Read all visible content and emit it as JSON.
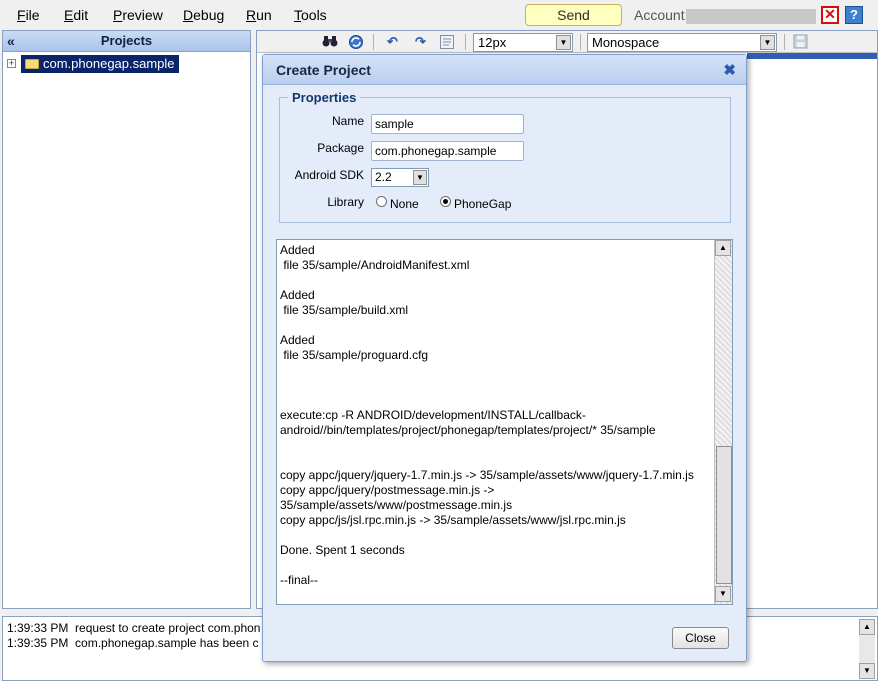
{
  "menu": {
    "items": [
      "File",
      "Edit",
      "Preview",
      "Debug",
      "Run",
      "Tools"
    ],
    "feedback_label": "Send Feedback",
    "account_label": "Account:"
  },
  "projects": {
    "title": "Projects",
    "collapse_glyph": "«",
    "items": [
      {
        "label": "com.phonegap.sample",
        "expander": "+"
      }
    ]
  },
  "toolbar": {
    "font_size": "12px",
    "font_family": "Monospace",
    "icons": [
      "binoculars-icon",
      "globe-refresh-icon",
      "undo-icon",
      "redo-icon",
      "format-icon",
      "save-icon"
    ]
  },
  "dialog": {
    "title": "Create Project",
    "close_glyph": "✖",
    "properties_legend": "Properties",
    "name_label": "Name",
    "name_value": "sample",
    "package_label": "Package",
    "package_value": "com.phonegap.sample",
    "sdk_label": "Android SDK",
    "sdk_value": "2.2",
    "library_label": "Library",
    "library_options": [
      {
        "label": "None",
        "checked": false
      },
      {
        "label": "PhoneGap",
        "checked": true
      }
    ],
    "output": "Added\n file 35/sample/AndroidManifest.xml\n\nAdded\n file 35/sample/build.xml\n\nAdded\n file 35/sample/proguard.cfg\n\n\n\nexecute:cp -R ANDROID/development/INSTALL/callback-android//bin/templates/project/phonegap/templates/project/* 35/sample\n\n\ncopy appc/jquery/jquery-1.7.min.js -> 35/sample/assets/www/jquery-1.7.min.js\ncopy appc/jquery/postmessage.min.js ->\n35/sample/assets/www/postmessage.min.js\ncopy appc/js/jsl.rpc.min.js -> 35/sample/assets/www/jsl.rpc.min.js\n\nDone. Spent 1 seconds\n\n--final--",
    "close_button": "Close"
  },
  "log": {
    "lines": [
      {
        "time": "1:39:33 PM",
        "text": "request to create project com.phon"
      },
      {
        "time": "1:39:35 PM",
        "text": "com.phonegap.sample has been c"
      }
    ]
  },
  "colors": {
    "accent": "#0a246a",
    "header_blue": "#b9cfee",
    "dialog_bg": "#e3ecf8",
    "feedback_bg": "#ffffc0",
    "close_red": "#d01010"
  }
}
